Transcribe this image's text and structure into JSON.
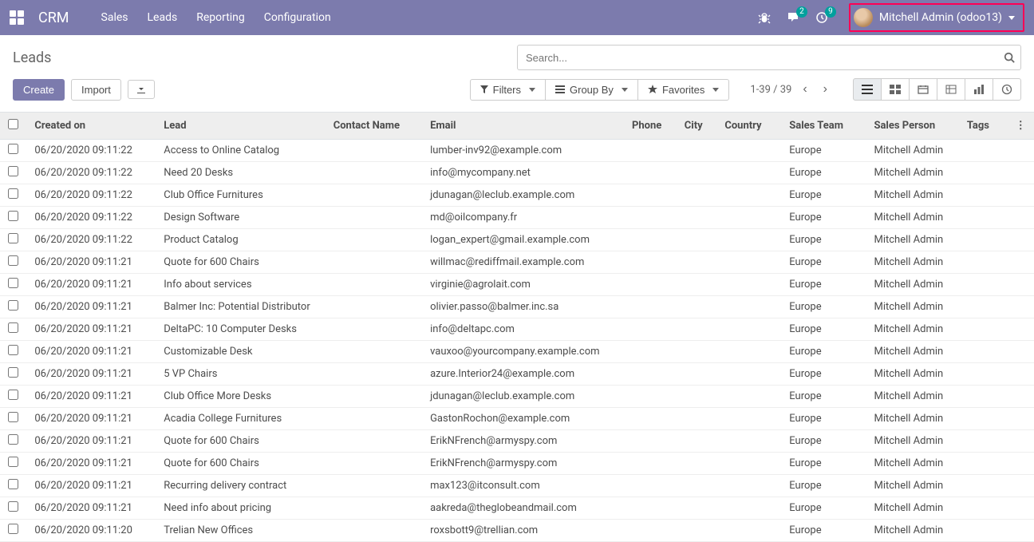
{
  "navbar": {
    "brand": "CRM",
    "menu": [
      "Sales",
      "Leads",
      "Reporting",
      "Configuration"
    ],
    "badges": {
      "chat": "2",
      "clock": "9"
    },
    "user": "Mitchell Admin (odoo13)"
  },
  "page": {
    "title": "Leads",
    "search_placeholder": "Search..."
  },
  "toolbar": {
    "create": "Create",
    "import": "Import",
    "filters": "Filters",
    "group_by": "Group By",
    "favorites": "Favorites",
    "pager": "1-39 / 39"
  },
  "columns": {
    "created_on": "Created on",
    "lead": "Lead",
    "contact_name": "Contact Name",
    "email": "Email",
    "phone": "Phone",
    "city": "City",
    "country": "Country",
    "sales_team": "Sales Team",
    "sales_person": "Sales Person",
    "tags": "Tags"
  },
  "rows": [
    {
      "created_on": "06/20/2020 09:11:22",
      "lead": "Access to Online Catalog",
      "contact_name": "",
      "email": "lumber-inv92@example.com",
      "phone": "",
      "city": "",
      "country": "",
      "sales_team": "Europe",
      "sales_person": "Mitchell Admin",
      "tags": ""
    },
    {
      "created_on": "06/20/2020 09:11:22",
      "lead": "Need 20 Desks",
      "contact_name": "",
      "email": "info@mycompany.net",
      "phone": "",
      "city": "",
      "country": "",
      "sales_team": "Europe",
      "sales_person": "Mitchell Admin",
      "tags": ""
    },
    {
      "created_on": "06/20/2020 09:11:22",
      "lead": "Club Office Furnitures",
      "contact_name": "",
      "email": "jdunagan@leclub.example.com",
      "phone": "",
      "city": "",
      "country": "",
      "sales_team": "Europe",
      "sales_person": "Mitchell Admin",
      "tags": ""
    },
    {
      "created_on": "06/20/2020 09:11:22",
      "lead": "Design Software",
      "contact_name": "",
      "email": "md@oilcompany.fr",
      "phone": "",
      "city": "",
      "country": "",
      "sales_team": "Europe",
      "sales_person": "Mitchell Admin",
      "tags": ""
    },
    {
      "created_on": "06/20/2020 09:11:22",
      "lead": "Product Catalog",
      "contact_name": "",
      "email": "logan_expert@gmail.example.com",
      "phone": "",
      "city": "",
      "country": "",
      "sales_team": "Europe",
      "sales_person": "Mitchell Admin",
      "tags": ""
    },
    {
      "created_on": "06/20/2020 09:11:21",
      "lead": "Quote for 600 Chairs",
      "contact_name": "",
      "email": "willmac@rediffmail.example.com",
      "phone": "",
      "city": "",
      "country": "",
      "sales_team": "Europe",
      "sales_person": "Mitchell Admin",
      "tags": ""
    },
    {
      "created_on": "06/20/2020 09:11:21",
      "lead": "Info about services",
      "contact_name": "",
      "email": "virginie@agrolait.com",
      "phone": "",
      "city": "",
      "country": "",
      "sales_team": "Europe",
      "sales_person": "Mitchell Admin",
      "tags": ""
    },
    {
      "created_on": "06/20/2020 09:11:21",
      "lead": "Balmer Inc: Potential Distributor",
      "contact_name": "",
      "email": "olivier.passo@balmer.inc.sa",
      "phone": "",
      "city": "",
      "country": "",
      "sales_team": "Europe",
      "sales_person": "Mitchell Admin",
      "tags": ""
    },
    {
      "created_on": "06/20/2020 09:11:21",
      "lead": "DeltaPC: 10 Computer Desks",
      "contact_name": "",
      "email": "info@deltapc.com",
      "phone": "",
      "city": "",
      "country": "",
      "sales_team": "Europe",
      "sales_person": "Mitchell Admin",
      "tags": ""
    },
    {
      "created_on": "06/20/2020 09:11:21",
      "lead": "Customizable Desk",
      "contact_name": "",
      "email": "vauxoo@yourcompany.example.com",
      "phone": "",
      "city": "",
      "country": "",
      "sales_team": "Europe",
      "sales_person": "Mitchell Admin",
      "tags": ""
    },
    {
      "created_on": "06/20/2020 09:11:21",
      "lead": "5 VP Chairs",
      "contact_name": "",
      "email": "azure.Interior24@example.com",
      "phone": "",
      "city": "",
      "country": "",
      "sales_team": "Europe",
      "sales_person": "Mitchell Admin",
      "tags": ""
    },
    {
      "created_on": "06/20/2020 09:11:21",
      "lead": "Club Office More Desks",
      "contact_name": "",
      "email": "jdunagan@leclub.example.com",
      "phone": "",
      "city": "",
      "country": "",
      "sales_team": "Europe",
      "sales_person": "Mitchell Admin",
      "tags": ""
    },
    {
      "created_on": "06/20/2020 09:11:21",
      "lead": "Acadia College Furnitures",
      "contact_name": "",
      "email": "GastonRochon@example.com",
      "phone": "",
      "city": "",
      "country": "",
      "sales_team": "Europe",
      "sales_person": "Mitchell Admin",
      "tags": ""
    },
    {
      "created_on": "06/20/2020 09:11:21",
      "lead": "Quote for 600 Chairs",
      "contact_name": "",
      "email": "ErikNFrench@armyspy.com",
      "phone": "",
      "city": "",
      "country": "",
      "sales_team": "Europe",
      "sales_person": "Mitchell Admin",
      "tags": ""
    },
    {
      "created_on": "06/20/2020 09:11:21",
      "lead": "Quote for 600 Chairs",
      "contact_name": "",
      "email": "ErikNFrench@armyspy.com",
      "phone": "",
      "city": "",
      "country": "",
      "sales_team": "Europe",
      "sales_person": "Mitchell Admin",
      "tags": ""
    },
    {
      "created_on": "06/20/2020 09:11:21",
      "lead": "Recurring delivery contract",
      "contact_name": "",
      "email": "max123@itconsult.com",
      "phone": "",
      "city": "",
      "country": "",
      "sales_team": "Europe",
      "sales_person": "Mitchell Admin",
      "tags": ""
    },
    {
      "created_on": "06/20/2020 09:11:21",
      "lead": "Need info about pricing",
      "contact_name": "",
      "email": "aakreda@theglobeandmail.com",
      "phone": "",
      "city": "",
      "country": "",
      "sales_team": "Europe",
      "sales_person": "Mitchell Admin",
      "tags": ""
    },
    {
      "created_on": "06/20/2020 09:11:20",
      "lead": "Trelian New Offices",
      "contact_name": "",
      "email": "roxsbott9@trellian.com",
      "phone": "",
      "city": "",
      "country": "",
      "sales_team": "Europe",
      "sales_person": "Mitchell Admin",
      "tags": ""
    }
  ]
}
